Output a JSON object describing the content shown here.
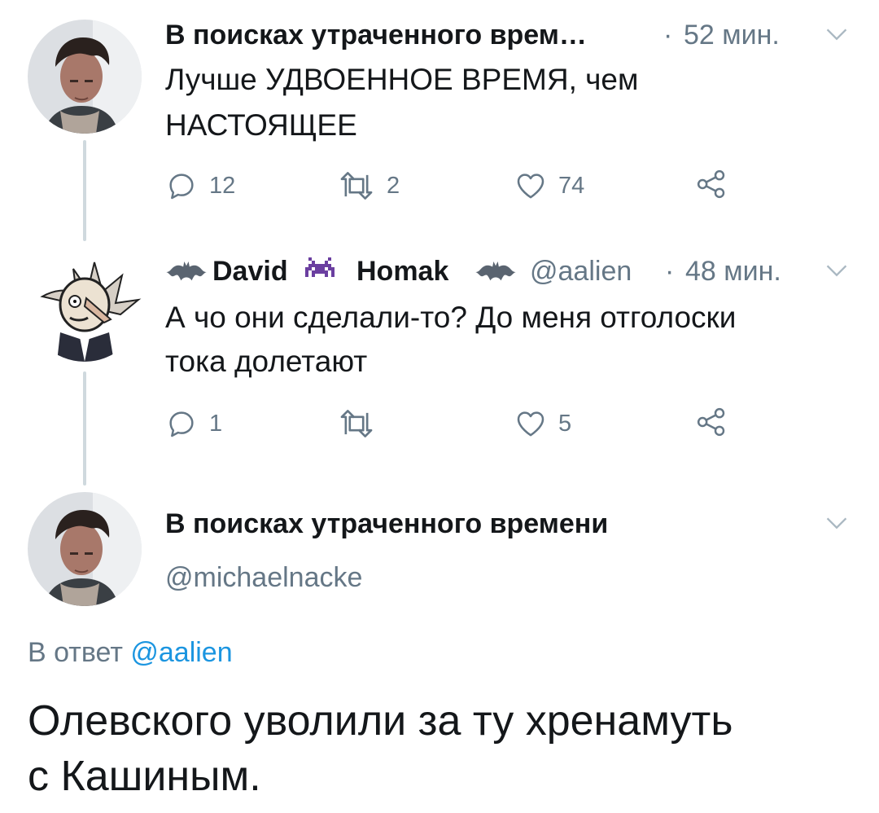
{
  "tweets": [
    {
      "author": "В поисках утраченного врем…",
      "separator": "·",
      "time": "52 мин.",
      "text_line1": "Лучше УДВОЕННОЕ ВРЕМЯ, чем",
      "text_line2": "НАСТОЯЩЕЕ",
      "replies": "12",
      "retweets": "2",
      "likes": "74"
    },
    {
      "author_first": "David",
      "author_last": "Homak",
      "handle": "@aalien",
      "separator": "·",
      "time": "48 мин.",
      "text_line1": "А чо они сделали-то? До меня отголоски",
      "text_line2": "тока долетают",
      "replies": "1",
      "retweets": "",
      "likes": "5"
    }
  ],
  "main_tweet": {
    "author": "В поисках утраченного времени",
    "handle": "@michaelnacke",
    "reply_to_prefix": "В ответ",
    "reply_to_handle": "@aalien",
    "text_line1": "Олевского уволили за ту хренамуть",
    "text_line2": "с Кашиным."
  },
  "icons": [
    "reply-icon",
    "retweet-icon",
    "like-icon",
    "share-icon",
    "chevron-down-icon",
    "bat-emoji-icon",
    "space-invader-icon"
  ],
  "colors": {
    "text": "#14171a",
    "secondary": "#657786",
    "link": "#1b95e0",
    "thread_line": "#cfd9de"
  }
}
